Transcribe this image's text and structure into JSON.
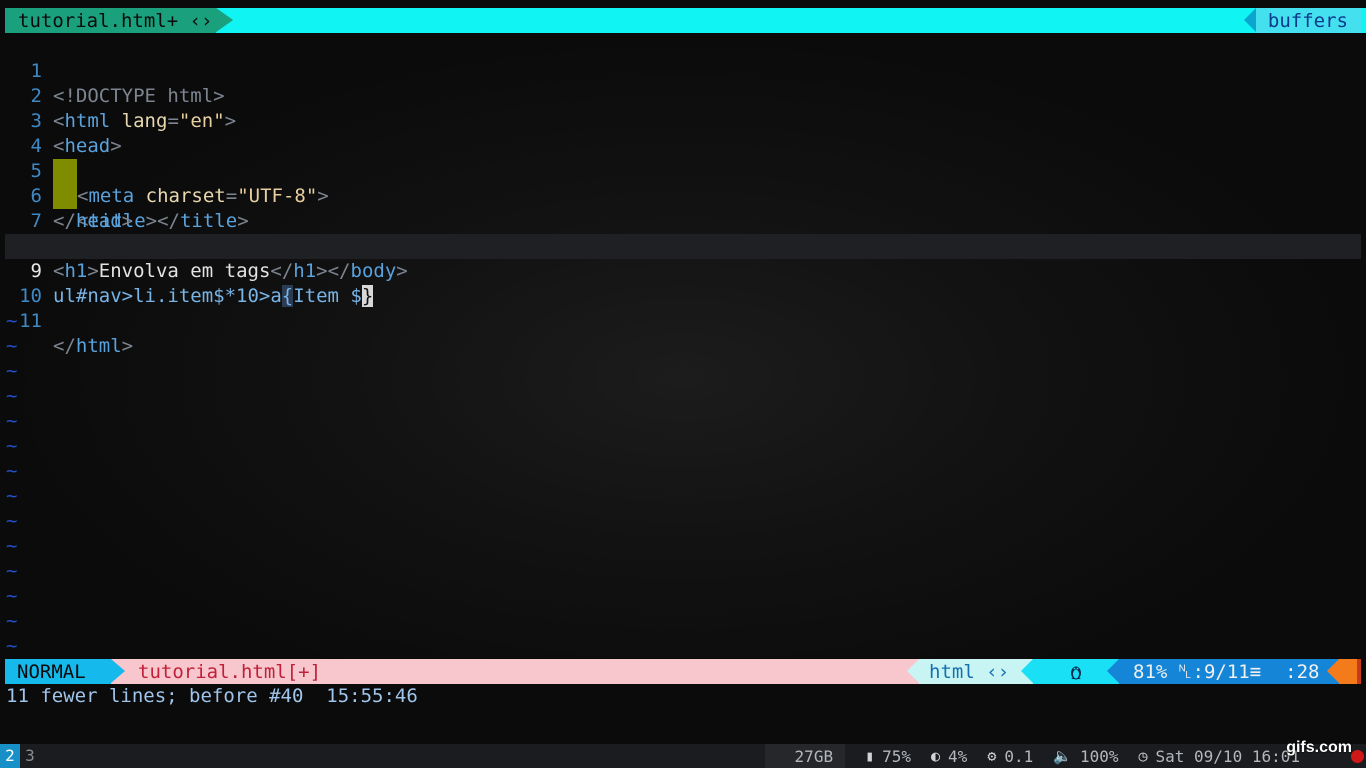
{
  "tabline": {
    "active_tab": "tutorial.html+ ‹›",
    "right_label": "buffers"
  },
  "editor": {
    "lines": [
      {
        "num": "1",
        "text": "<!DOCTYPE html>"
      },
      {
        "num": "2",
        "text": "<html lang=\"en\">"
      },
      {
        "num": "3",
        "text": "<head>"
      },
      {
        "num": "4",
        "text": "<meta charset=\"UTF-8\">"
      },
      {
        "num": "5",
        "text": "<title></title>"
      },
      {
        "num": "6",
        "text": "</head>"
      },
      {
        "num": "7",
        "text": "<body>"
      },
      {
        "num": "8",
        "text": "<h1>Envolva em tags</h1></body>"
      },
      {
        "num": "9",
        "text": "ul#nav>li.item$*10>a{Item $}"
      },
      {
        "num": "10",
        "text": ""
      },
      {
        "num": "11",
        "text": "</html>"
      }
    ],
    "tilde": "~"
  },
  "statusline": {
    "mode": "NORMAL",
    "filename": "tutorial.html[+]",
    "filetype": "html ‹›",
    "os_icon": "linux-tux-icon",
    "percent": "81%",
    "position": "␤:9/11≡",
    "column": ":28"
  },
  "message": "11 fewer lines; before #40  15:55:46",
  "sysbar": {
    "workspace_active": "2",
    "workspace_other": "3",
    "disk": "27GB",
    "memory": "75%",
    "cpu": "4%",
    "load": "0.1",
    "volume": "100%",
    "datetime": "Sat 09/10 16:01"
  },
  "watermark": "gifs.com",
  "colors": {
    "tab_active": "#1aa07c",
    "tab_fill": "#11f4f4",
    "mode_bg": "#15b9ec",
    "filename_bg": "#f7c7cd",
    "filename_fg": "#c0203a",
    "position_bg": "#1585d8"
  }
}
